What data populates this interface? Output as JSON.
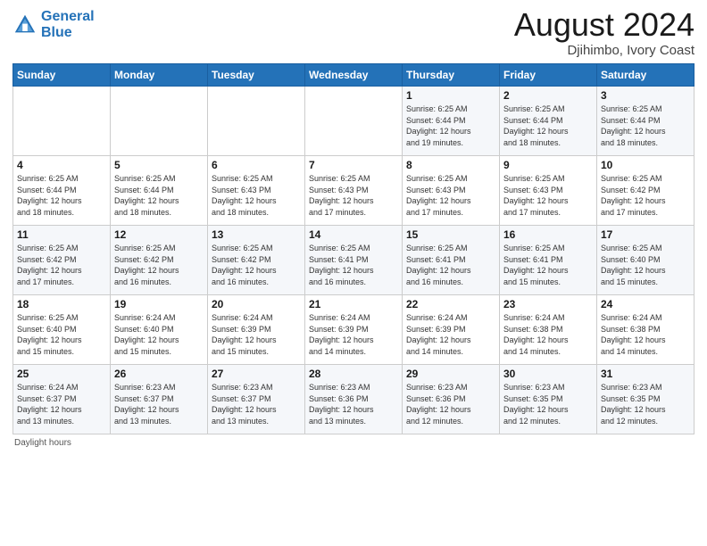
{
  "header": {
    "logo_line1": "General",
    "logo_line2": "Blue",
    "month_title": "August 2024",
    "location": "Djihimbo, Ivory Coast"
  },
  "days_of_week": [
    "Sunday",
    "Monday",
    "Tuesday",
    "Wednesday",
    "Thursday",
    "Friday",
    "Saturday"
  ],
  "footer": {
    "daylight_label": "Daylight hours"
  },
  "weeks": [
    [
      {
        "day": "",
        "info": ""
      },
      {
        "day": "",
        "info": ""
      },
      {
        "day": "",
        "info": ""
      },
      {
        "day": "",
        "info": ""
      },
      {
        "day": "1",
        "info": "Sunrise: 6:25 AM\nSunset: 6:44 PM\nDaylight: 12 hours\nand 19 minutes."
      },
      {
        "day": "2",
        "info": "Sunrise: 6:25 AM\nSunset: 6:44 PM\nDaylight: 12 hours\nand 18 minutes."
      },
      {
        "day": "3",
        "info": "Sunrise: 6:25 AM\nSunset: 6:44 PM\nDaylight: 12 hours\nand 18 minutes."
      }
    ],
    [
      {
        "day": "4",
        "info": "Sunrise: 6:25 AM\nSunset: 6:44 PM\nDaylight: 12 hours\nand 18 minutes."
      },
      {
        "day": "5",
        "info": "Sunrise: 6:25 AM\nSunset: 6:44 PM\nDaylight: 12 hours\nand 18 minutes."
      },
      {
        "day": "6",
        "info": "Sunrise: 6:25 AM\nSunset: 6:43 PM\nDaylight: 12 hours\nand 18 minutes."
      },
      {
        "day": "7",
        "info": "Sunrise: 6:25 AM\nSunset: 6:43 PM\nDaylight: 12 hours\nand 17 minutes."
      },
      {
        "day": "8",
        "info": "Sunrise: 6:25 AM\nSunset: 6:43 PM\nDaylight: 12 hours\nand 17 minutes."
      },
      {
        "day": "9",
        "info": "Sunrise: 6:25 AM\nSunset: 6:43 PM\nDaylight: 12 hours\nand 17 minutes."
      },
      {
        "day": "10",
        "info": "Sunrise: 6:25 AM\nSunset: 6:42 PM\nDaylight: 12 hours\nand 17 minutes."
      }
    ],
    [
      {
        "day": "11",
        "info": "Sunrise: 6:25 AM\nSunset: 6:42 PM\nDaylight: 12 hours\nand 17 minutes."
      },
      {
        "day": "12",
        "info": "Sunrise: 6:25 AM\nSunset: 6:42 PM\nDaylight: 12 hours\nand 16 minutes."
      },
      {
        "day": "13",
        "info": "Sunrise: 6:25 AM\nSunset: 6:42 PM\nDaylight: 12 hours\nand 16 minutes."
      },
      {
        "day": "14",
        "info": "Sunrise: 6:25 AM\nSunset: 6:41 PM\nDaylight: 12 hours\nand 16 minutes."
      },
      {
        "day": "15",
        "info": "Sunrise: 6:25 AM\nSunset: 6:41 PM\nDaylight: 12 hours\nand 16 minutes."
      },
      {
        "day": "16",
        "info": "Sunrise: 6:25 AM\nSunset: 6:41 PM\nDaylight: 12 hours\nand 15 minutes."
      },
      {
        "day": "17",
        "info": "Sunrise: 6:25 AM\nSunset: 6:40 PM\nDaylight: 12 hours\nand 15 minutes."
      }
    ],
    [
      {
        "day": "18",
        "info": "Sunrise: 6:25 AM\nSunset: 6:40 PM\nDaylight: 12 hours\nand 15 minutes."
      },
      {
        "day": "19",
        "info": "Sunrise: 6:24 AM\nSunset: 6:40 PM\nDaylight: 12 hours\nand 15 minutes."
      },
      {
        "day": "20",
        "info": "Sunrise: 6:24 AM\nSunset: 6:39 PM\nDaylight: 12 hours\nand 15 minutes."
      },
      {
        "day": "21",
        "info": "Sunrise: 6:24 AM\nSunset: 6:39 PM\nDaylight: 12 hours\nand 14 minutes."
      },
      {
        "day": "22",
        "info": "Sunrise: 6:24 AM\nSunset: 6:39 PM\nDaylight: 12 hours\nand 14 minutes."
      },
      {
        "day": "23",
        "info": "Sunrise: 6:24 AM\nSunset: 6:38 PM\nDaylight: 12 hours\nand 14 minutes."
      },
      {
        "day": "24",
        "info": "Sunrise: 6:24 AM\nSunset: 6:38 PM\nDaylight: 12 hours\nand 14 minutes."
      }
    ],
    [
      {
        "day": "25",
        "info": "Sunrise: 6:24 AM\nSunset: 6:37 PM\nDaylight: 12 hours\nand 13 minutes."
      },
      {
        "day": "26",
        "info": "Sunrise: 6:23 AM\nSunset: 6:37 PM\nDaylight: 12 hours\nand 13 minutes."
      },
      {
        "day": "27",
        "info": "Sunrise: 6:23 AM\nSunset: 6:37 PM\nDaylight: 12 hours\nand 13 minutes."
      },
      {
        "day": "28",
        "info": "Sunrise: 6:23 AM\nSunset: 6:36 PM\nDaylight: 12 hours\nand 13 minutes."
      },
      {
        "day": "29",
        "info": "Sunrise: 6:23 AM\nSunset: 6:36 PM\nDaylight: 12 hours\nand 12 minutes."
      },
      {
        "day": "30",
        "info": "Sunrise: 6:23 AM\nSunset: 6:35 PM\nDaylight: 12 hours\nand 12 minutes."
      },
      {
        "day": "31",
        "info": "Sunrise: 6:23 AM\nSunset: 6:35 PM\nDaylight: 12 hours\nand 12 minutes."
      }
    ]
  ]
}
